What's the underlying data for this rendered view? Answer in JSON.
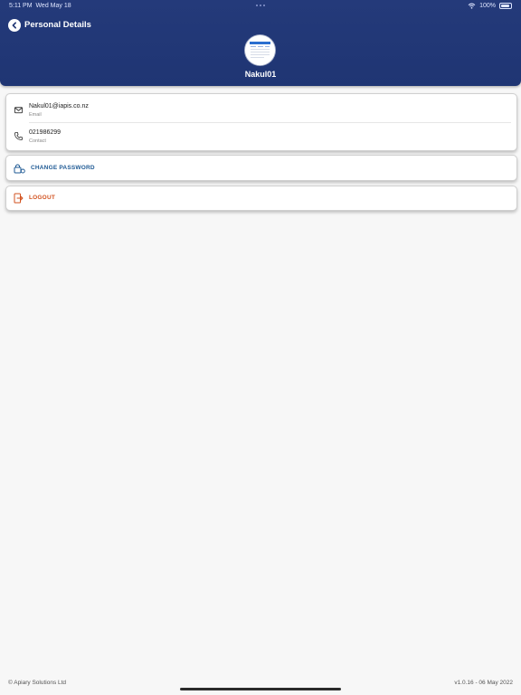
{
  "status_bar": {
    "time": "5:11 PM",
    "date": "Wed May 18",
    "battery": "100%"
  },
  "header": {
    "title": "Personal Details",
    "username": "Nakul01"
  },
  "details": {
    "email": {
      "value": "Nakul01@iapis.co.nz",
      "caption": "Email"
    },
    "contact": {
      "value": "021986299",
      "caption": "Contact"
    }
  },
  "actions": {
    "change_password": "CHANGE PASSWORD",
    "logout": "LOGOUT"
  },
  "footer": {
    "copyright": "© Apiary Solutions Ltd",
    "version": "v1.0.16 - 06 May 2022"
  },
  "colors": {
    "header": "#1f3573",
    "link_blue": "#1f5a94",
    "logout_orange": "#d2521f",
    "background": "#f7f7f7"
  }
}
